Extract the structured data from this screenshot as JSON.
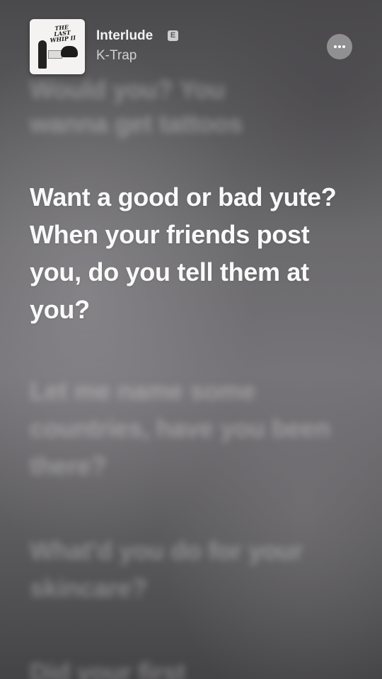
{
  "now_playing": {
    "title": "Interlude",
    "explicit_badge": "E",
    "artist": "K-Trap",
    "artwork_title": "THE LAST WHIP II",
    "more_icon": "ellipsis-icon"
  },
  "lyrics": {
    "previous": "wanna get tattoos",
    "previous_partial": "Would you? You",
    "current": "Want a good or bad yute? When your friends post you, do you tell them at you?",
    "next": [
      "Let me name some countries, have you been there?",
      "What'd you do for your skincare?",
      "Did your first"
    ]
  },
  "colors": {
    "background": "#5e5c5f",
    "active_text": "#ffffff",
    "inactive_text": "rgba(255,255,255,0.30)"
  }
}
